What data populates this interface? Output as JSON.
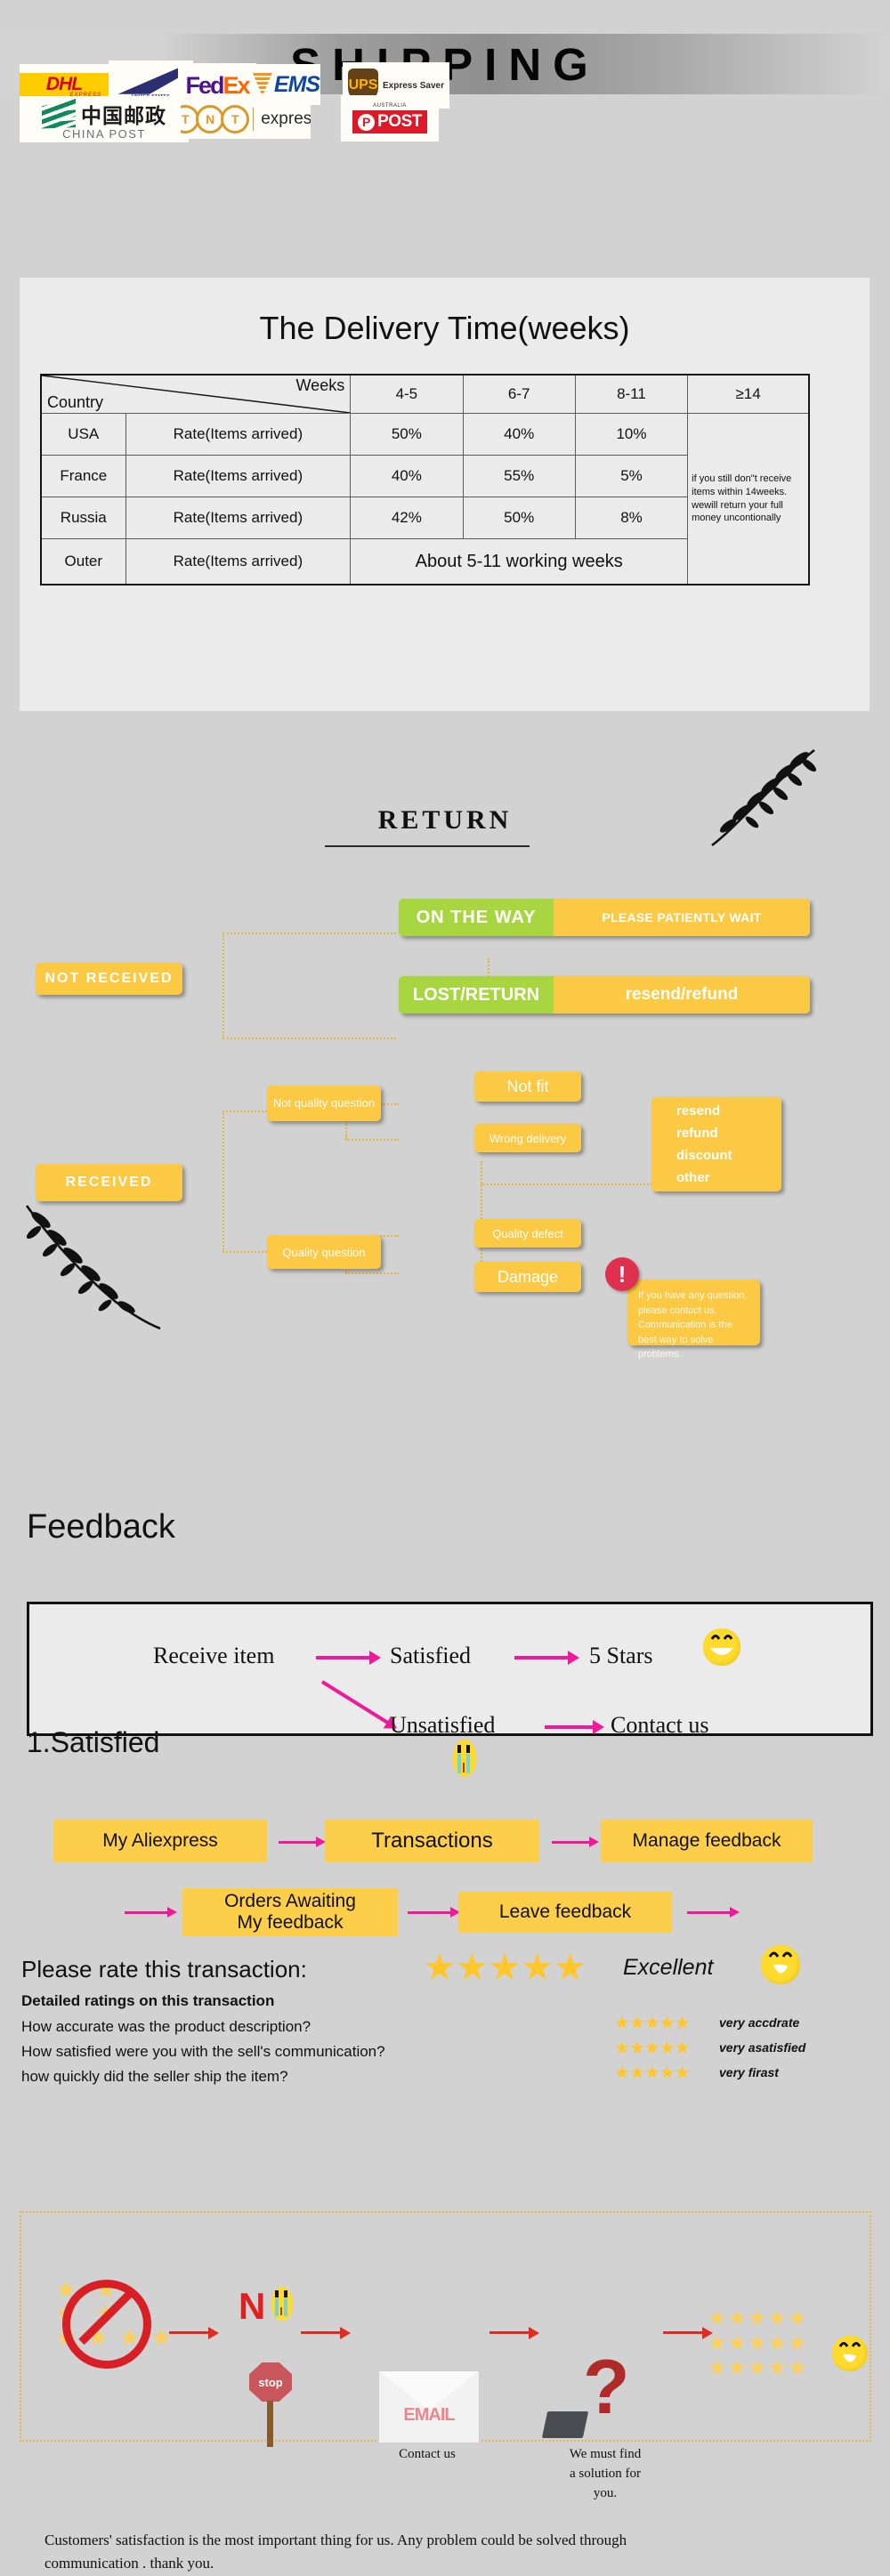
{
  "shipping": {
    "title": "SHIPPING",
    "carriers": [
      {
        "name": "DHL",
        "word": "DHL",
        "sub": "EXPRESS"
      },
      {
        "name": "USPS",
        "line1": "UNITED STATES",
        "line2": "POSTAL SERVICE."
      },
      {
        "name": "FedEx",
        "part1": "Fed",
        "part2": "Ex"
      },
      {
        "name": "EMS",
        "word": "EMS"
      },
      {
        "name": "UPS",
        "word": "UPS",
        "label": "Express Saver"
      },
      {
        "name": "China Post",
        "cn": "中国邮政",
        "en": "CHINA POST"
      },
      {
        "name": "TNT express",
        "o1": "T",
        "o2": "N",
        "o3": "T",
        "word": "express"
      },
      {
        "name": "Australia Post",
        "top": "AUSTRALIA",
        "p": "P",
        "word": "POST"
      }
    ]
  },
  "delivery": {
    "title": "The Delivery Time(weeks)",
    "header_diag_top": "Weeks",
    "header_diag_bottom": "Country",
    "columns": [
      "4-5",
      "6-7",
      "8-11",
      "≥14"
    ],
    "rate_label": "Rate(Items arrived)",
    "rows": [
      {
        "country": "USA",
        "rate": "Rate(Items arrived)",
        "values": [
          "50%",
          "40%",
          "10%"
        ]
      },
      {
        "country": "France",
        "rate": "Rate(Items arrived)",
        "values": [
          "40%",
          "55%",
          "5%"
        ]
      },
      {
        "country": "Russia",
        "rate": "Rate(Items arrived)",
        "values": [
          "42%",
          "50%",
          "8%"
        ]
      }
    ],
    "outer_row": {
      "country": "Outer",
      "rate": "Rate(Items arrived)",
      "span_text": "About 5-11 working weeks"
    },
    "note": "if you still don\"t receive items within 14weeks. wewill return your full money uncontionally"
  },
  "return": {
    "title": "RETURN",
    "not_received": "NOT RECEIVED",
    "received": "RECEIVED",
    "on_the_way": "ON THE WAY",
    "on_the_way_action": "PLEASE PATIENTLY WAIT",
    "lost_return": "LOST/RETURN",
    "lost_return_action": "resend/refund",
    "not_quality": "Not quality question",
    "quality_question": "Quality question",
    "not_fit": "Not fit",
    "wrong_delivery": "Wrong delivery",
    "quality_defect": "Quality defect",
    "damage": "Damage",
    "outcomes": [
      "resend",
      "refund",
      "discount",
      "other"
    ],
    "note": "If you have any question, please contoct us. Communication is the best way to solve problems.",
    "bang_icon": "!"
  },
  "feedback": {
    "heading": "Feedback",
    "receive_item": "Receive item",
    "satisfied": "Satisfied",
    "five_stars": "5 Stars",
    "unsatisfied": "Unsatisfied",
    "contact_us": "Contact us"
  },
  "satisfied_flow": {
    "heading": "1.Satisfied",
    "step1": "My Aliexpress",
    "step2": "Transactions",
    "step3": "Manage feedback",
    "step4": "Orders Awaiting My feedback",
    "step4_line1": "Orders Awaiting",
    "step4_line2": "My feedback",
    "step5": "Leave feedback"
  },
  "ratings": {
    "prompt": "Please rate this transaction:",
    "prompt_stars": "★★★★★",
    "prompt_word": "Excellent",
    "detailed_heading": "Detailed ratings on this transaction",
    "items": [
      {
        "question": "How accurate was the product description?",
        "stars": "★★★★★",
        "word": "very accdrate"
      },
      {
        "question": "How satisfied were you with the sell's communication?",
        "stars": "★★★★★",
        "word": "very asatisfied"
      },
      {
        "question": "how quickly did the seller ship the item?",
        "stars": "★★★★★",
        "word": "very firast"
      }
    ]
  },
  "bottom": {
    "no_label": "N",
    "stop_label": "stop",
    "email_label": "EMAIL",
    "question_mark": "?",
    "caption_contact": "Contact us",
    "caption_solution_line1": "We must find",
    "caption_solution_line2": "a solution for",
    "caption_solution_line3": "you.",
    "footer_line1": "Customers' satisfaction is the most important thing for us. Any problem could be solved through",
    "footer_line2": "communication . thank you."
  },
  "colors": {
    "page_bg": "#d2d2d2",
    "panel_bg": "#ebebeb",
    "yellow": "#fbc943",
    "green": "#a8d641",
    "magenta": "#f0199a",
    "star": "#ffc72c",
    "red": "#d81f26"
  }
}
